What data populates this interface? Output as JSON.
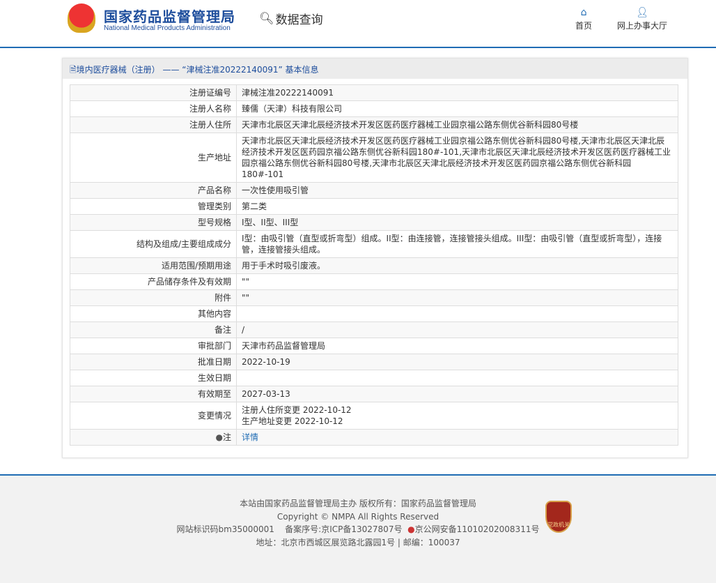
{
  "header": {
    "site_name_cn": "国家药品监督管理局",
    "site_name_en": "National Medical Products Administration",
    "section": "数据查询",
    "nav": [
      {
        "label": "首页",
        "icon": "home-icon"
      },
      {
        "label": "网上办事大厅",
        "icon": "user-icon"
      }
    ]
  },
  "panel": {
    "title": "境内医疗器械（注册） —— “津械注准20222140091” 基本信息"
  },
  "rows": [
    {
      "label": "注册证编号",
      "value": "津械注准20222140091"
    },
    {
      "label": "注册人名称",
      "value": "臻儒（天津）科技有限公司"
    },
    {
      "label": "注册人住所",
      "value": "天津市北辰区天津北辰经济技术开发区医药医疗器械工业园京福公路东侧优谷新科园80号楼"
    },
    {
      "label": "生产地址",
      "value": "天津市北辰区天津北辰经济技术开发区医药医疗器械工业园京福公路东侧优谷新科园80号楼,天津市北辰区天津北辰经济技术开发区医药园京福公路东侧优谷新科园180#-101,天津市北辰区天津北辰经济技术开发区医药医疗器械工业园京福公路东侧优谷新科园80号楼,天津市北辰区天津北辰经济技术开发区医药园京福公路东侧优谷新科园180#-101"
    },
    {
      "label": "产品名称",
      "value": "一次性使用吸引管"
    },
    {
      "label": "管理类别",
      "value": "第二类"
    },
    {
      "label": "型号规格",
      "value": "I型、II型、III型"
    },
    {
      "label": "结构及组成/主要组成成分",
      "value": "I型：由吸引管（直型或折弯型）组成。II型：由连接管，连接管接头组成。III型：由吸引管（直型或折弯型），连接管，连接管接头组成。"
    },
    {
      "label": "适用范围/预期用途",
      "value": "用于手术时吸引废液。"
    },
    {
      "label": "产品储存条件及有效期",
      "value": "\"\""
    },
    {
      "label": "附件",
      "value": "\"\""
    },
    {
      "label": "其他内容",
      "value": ""
    },
    {
      "label": "备注",
      "value": "/"
    },
    {
      "label": "审批部门",
      "value": "天津市药品监督管理局"
    },
    {
      "label": "批准日期",
      "value": "2022-10-19"
    },
    {
      "label": "生效日期",
      "value": ""
    },
    {
      "label": "有效期至",
      "value": "2027-03-13"
    },
    {
      "label": "变更情况",
      "value": "注册人住所变更 2022-10-12",
      "value2": "生产地址变更 2022-10-12"
    },
    {
      "label": "注",
      "value": "详情"
    }
  ],
  "footer": {
    "line1": "本站由国家药品监督管理局主办 版权所有：国家药品监督管理局",
    "line2": "Copyright © NMPA All Rights Reserved",
    "site_id": "网站标识码bm35000001",
    "icp": "备案序号:京ICP备13027807号",
    "police": "京公网安备11010202008311号",
    "address": "地址：北京市西城区展览路北露园1号 | 邮编：100037",
    "badge": "党政机关"
  }
}
